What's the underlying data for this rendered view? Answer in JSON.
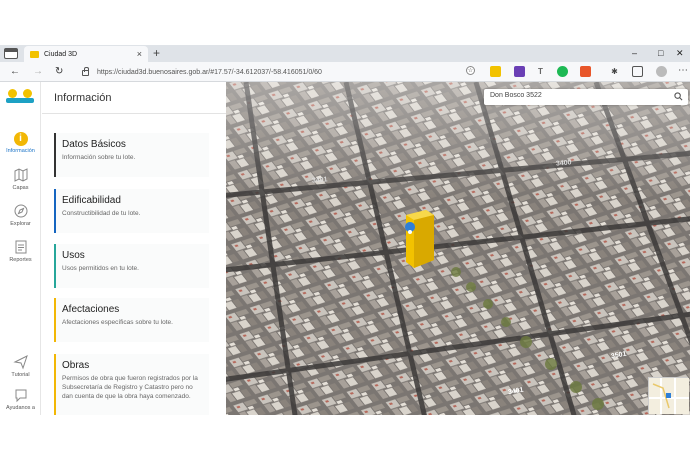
{
  "browser": {
    "tab_title": "Ciudad 3D",
    "tab_close": "×",
    "new_tab": "+",
    "url": "https://ciudad3d.buenosaires.gob.ar/#17.57/-34.612037/-58.416051/0/60"
  },
  "sidebar": {
    "items": [
      {
        "label": "Información",
        "icon": "info-icon"
      },
      {
        "label": "Capas",
        "icon": "map-icon"
      },
      {
        "label": "Explorar",
        "icon": "compass-icon"
      },
      {
        "label": "Reportes",
        "icon": "report-icon"
      },
      {
        "label": "Tutorial",
        "icon": "send-icon"
      },
      {
        "label": "Ayudanos a",
        "icon": "chat-icon"
      }
    ]
  },
  "panel": {
    "title": "Información",
    "cards": [
      {
        "title": "Datos Básicos",
        "desc": "Información sobre tu lote.",
        "accent": "#333333"
      },
      {
        "title": "Edificabilidad",
        "desc": "Constructibilidad de tu lote.",
        "accent": "#1565c0"
      },
      {
        "title": "Usos",
        "desc": "Usos permitidos en tu lote.",
        "accent": "#26a69a"
      },
      {
        "title": "Afectaciones",
        "desc": "Afectaciones específicas sobre tu lote.",
        "accent": "#f2b705"
      },
      {
        "title": "Obras",
        "desc": "Permisos de obra que fueron registrados por la Subsecretaría de Registro y Catastro pero no dan cuenta de que la obra haya comenzado.",
        "accent": "#f2b705"
      }
    ]
  },
  "map": {
    "search_value": "Don Bosco 3522",
    "street_labels": [
      "3401",
      "3400",
      "3501",
      "3401"
    ],
    "highlight_color": "#f2c200",
    "pin_color": "#2f7fd6"
  }
}
